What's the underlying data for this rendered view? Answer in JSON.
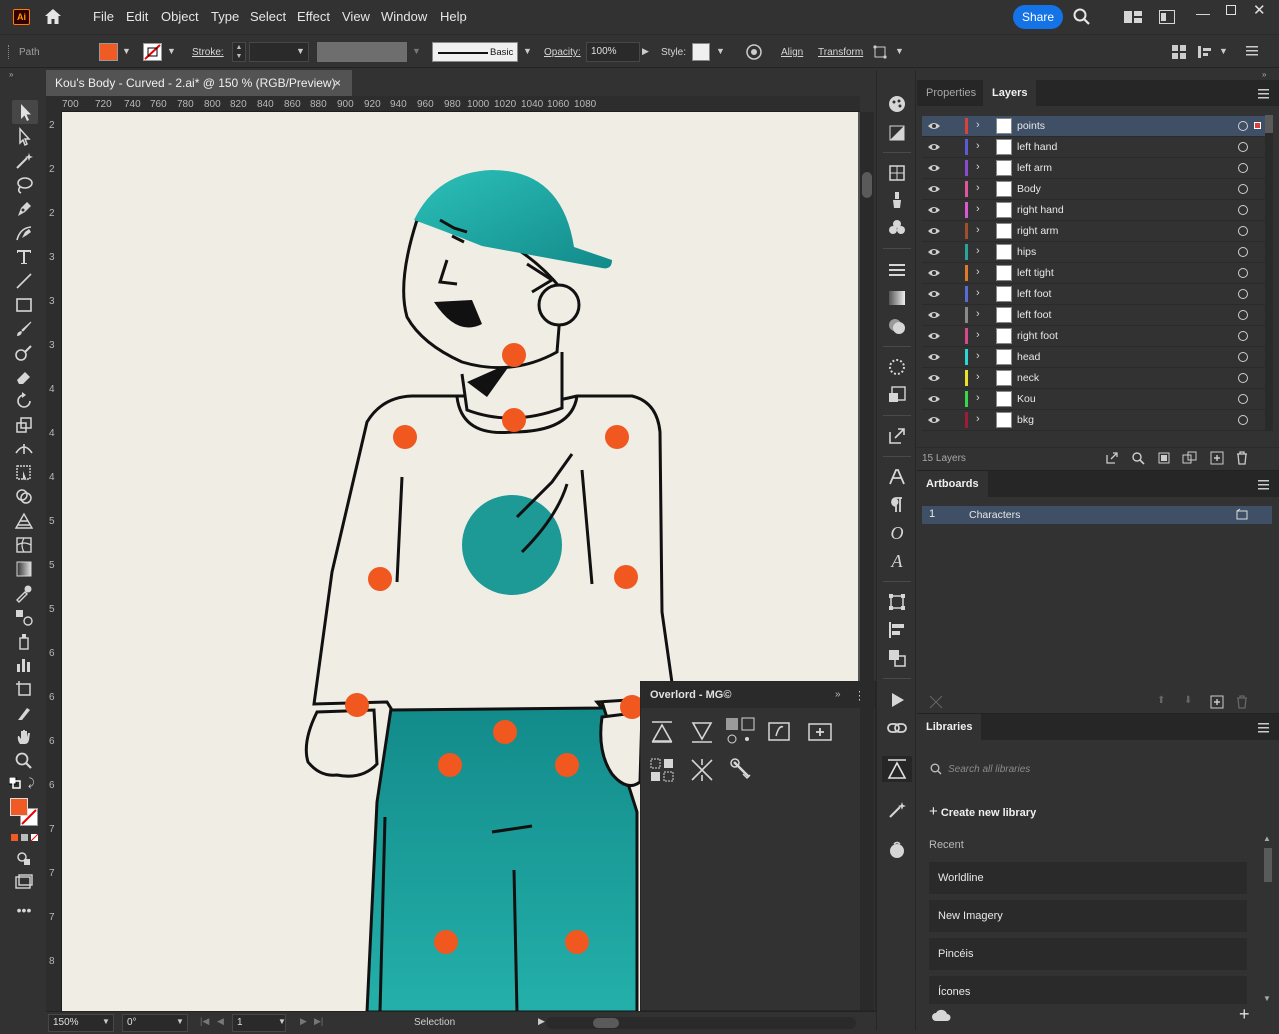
{
  "app": {
    "logo": "Ai",
    "accent": "#ff9a00"
  },
  "menu": [
    "File",
    "Edit",
    "Object",
    "Type",
    "Select",
    "Effect",
    "View",
    "Window",
    "Help"
  ],
  "share_label": "Share",
  "control": {
    "selection_type": "Path",
    "stroke_label": "Stroke:",
    "brush_label": "Basic",
    "opacity_label": "Opacity:",
    "opacity_value": "100%",
    "style_label": "Style:",
    "align_label": "Align",
    "transform_label": "Transform",
    "fill_color": "#f05a24"
  },
  "document": {
    "tab_title": "Kou's Body - Curved - 2.ai* @ 150 % (RGB/Preview)",
    "close": "×"
  },
  "ruler": {
    "h": [
      "700",
      "720",
      "740",
      "760",
      "780",
      "800",
      "820",
      "840",
      "860",
      "880",
      "900",
      "920",
      "940",
      "960",
      "980",
      "1000",
      "1020",
      "1040",
      "1060",
      "1080"
    ],
    "v": [
      "2",
      "2",
      "2",
      "3",
      "3",
      "3",
      "4",
      "4",
      "4",
      "5",
      "5",
      "5",
      "6",
      "6",
      "6",
      "6",
      "7",
      "7",
      "7",
      "8"
    ]
  },
  "artwork": {
    "background": "#efede4",
    "teal": "#1d9a96",
    "teal_light": "#2cc0b8",
    "dot": "#f0581f",
    "ink": "#111111"
  },
  "status": {
    "zoom": "150%",
    "rotation": "0°",
    "artboard": "1",
    "tool": "Selection"
  },
  "panels": {
    "tabs": [
      "Properties",
      "Layers"
    ],
    "layers": [
      {
        "name": "points",
        "color": "#d9413b",
        "selected": true
      },
      {
        "name": "left hand",
        "color": "#5b5bd6"
      },
      {
        "name": "left arm",
        "color": "#8a4ad1"
      },
      {
        "name": "Body",
        "color": "#e0559b"
      },
      {
        "name": "right hand",
        "color": "#d85ad1"
      },
      {
        "name": "right arm",
        "color": "#a04e2b"
      },
      {
        "name": "hips",
        "color": "#2aa39a"
      },
      {
        "name": "left tight",
        "color": "#e07a2a"
      },
      {
        "name": "left foot",
        "color": "#5b6bd6"
      },
      {
        "name": "left foot",
        "color": "#8a8a8a"
      },
      {
        "name": "right foot",
        "color": "#d64a8a"
      },
      {
        "name": "head",
        "color": "#2ad6d6"
      },
      {
        "name": "neck",
        "color": "#e8e22a"
      },
      {
        "name": "Kou",
        "color": "#3ad64a"
      },
      {
        "name": "bkg",
        "color": "#a01a3a"
      }
    ],
    "layers_count": "15 Layers",
    "artboards_title": "Artboards",
    "artboard_row": {
      "number": "1",
      "name": "Characters"
    },
    "libraries_title": "Libraries",
    "search_placeholder": "Search all libraries",
    "create_library": "Create new library",
    "recent_label": "Recent",
    "libraries": [
      "Worldline",
      "New Imagery",
      "Pincéis",
      "Ícones"
    ]
  },
  "overlord": {
    "title": "Overlord - MG©"
  }
}
